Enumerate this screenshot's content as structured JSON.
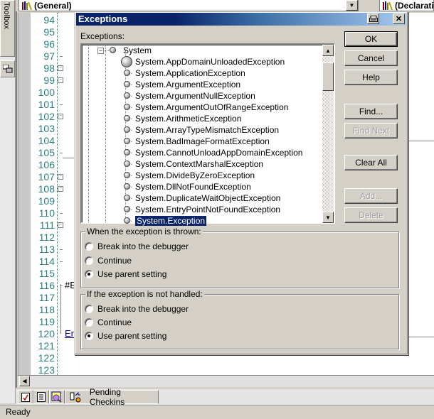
{
  "ide": {
    "toolbox_label": "Toolbox",
    "combo_left": "(General)",
    "combo_right": "(Declarations",
    "line_numbers": [
      "94",
      "95",
      "96",
      "97",
      "98",
      "99",
      "100",
      "101",
      "102",
      "103",
      "104",
      "105",
      "106",
      "107",
      "108",
      "109",
      "110",
      "111",
      "112",
      "113",
      "114",
      "115",
      "116",
      "117",
      "118",
      "119",
      "120",
      "121",
      "122",
      "123"
    ],
    "code_fragments": {
      "line116": "#E",
      "line120": "Er"
    },
    "bottom_tabs": {
      "pending_checkins": "Pending Checkins"
    },
    "status": "Ready"
  },
  "dialog": {
    "title": "Exceptions",
    "exceptions_label": "Exceptions:",
    "tree": {
      "root": "System",
      "items": [
        "System.AppDomainUnloadedException",
        "System.ApplicationException",
        "System.ArgumentException",
        "System.ArgumentNullException",
        "System.ArgumentOutOfRangeException",
        "System.ArithmeticException",
        "System.ArrayTypeMismatchException",
        "System.BadImageFormatException",
        "System.CannotUnloadAppDomainException",
        "System.ContextMarshalException",
        "System.DivideByZeroException",
        "System.DllNotFoundException",
        "System.DuplicateWaitObjectException",
        "System.EntryPointNotFoundException",
        "System.Exception"
      ],
      "selected": "System.Exception"
    },
    "buttons": {
      "ok": "OK",
      "cancel": "Cancel",
      "help": "Help",
      "find": "Find...",
      "find_next": "Find Next",
      "clear_all": "Clear All",
      "add": "Add...",
      "delete": "Delete"
    },
    "thrown_group": {
      "label": "When the exception is thrown:",
      "options": [
        "Break into the debugger",
        "Continue",
        "Use parent setting"
      ],
      "selected": "Use parent setting"
    },
    "unhandled_group": {
      "label": "If the exception is not handled:",
      "options": [
        "Break into the debugger",
        "Continue",
        "Use parent setting"
      ],
      "selected": "Use parent setting"
    }
  }
}
